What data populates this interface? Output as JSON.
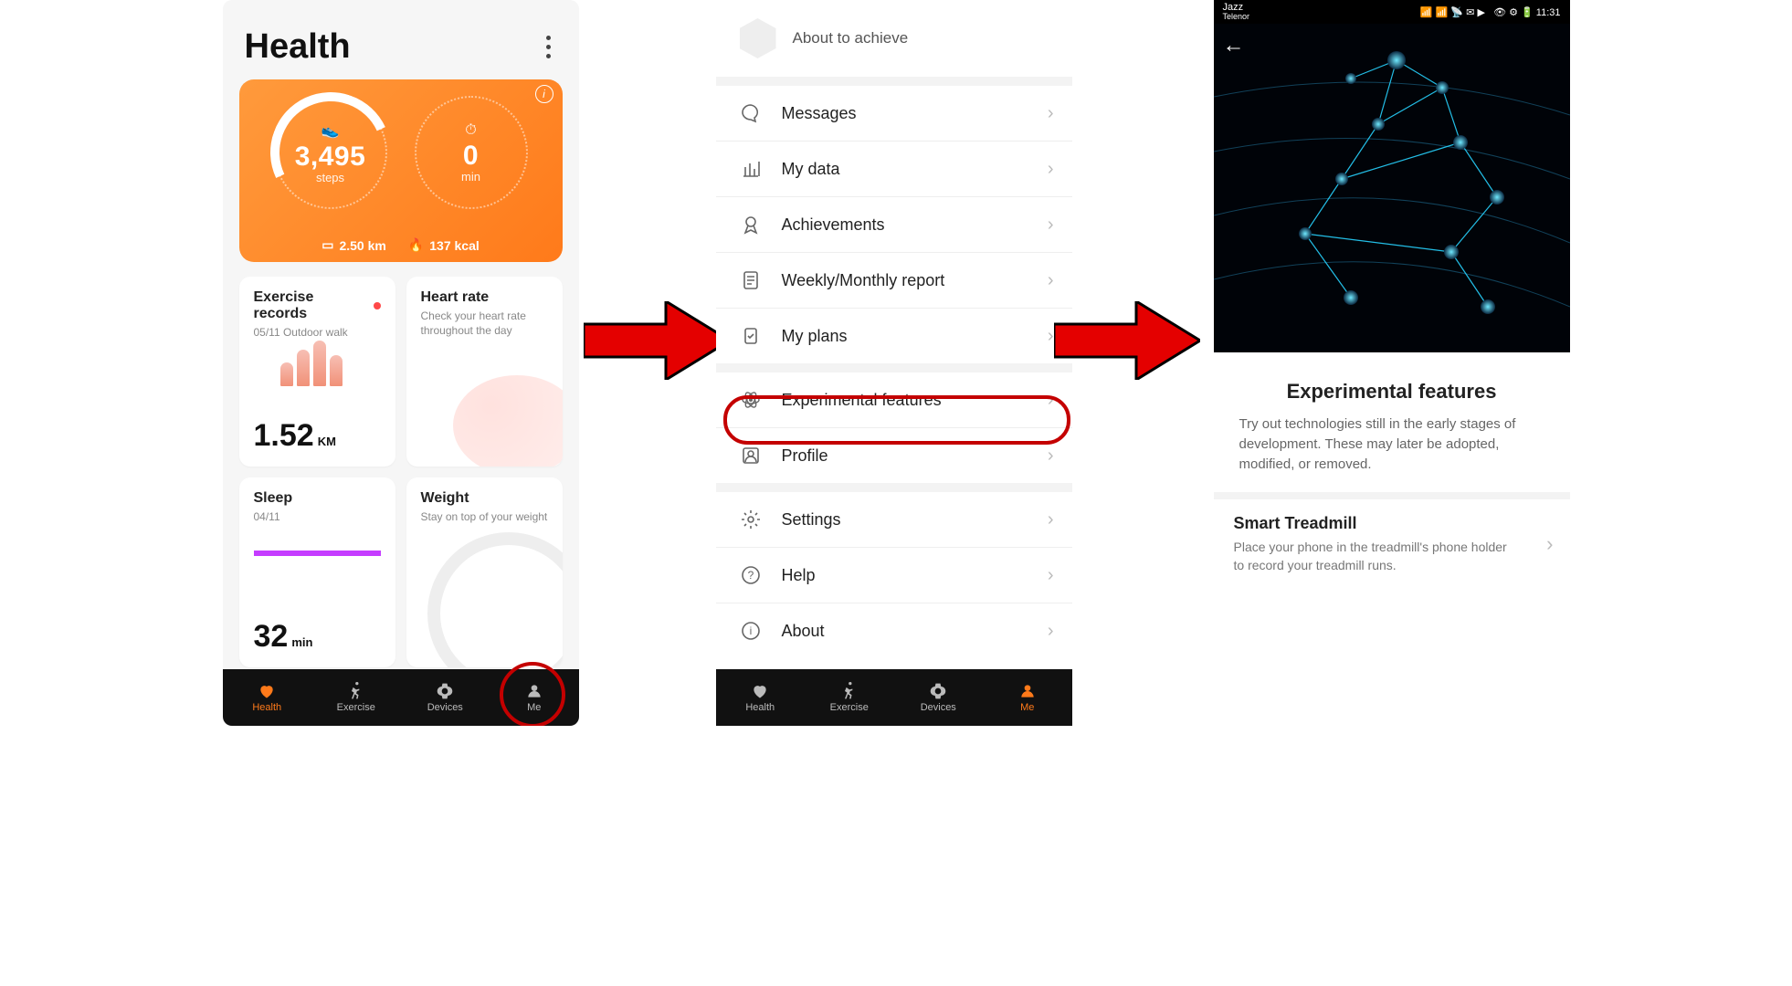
{
  "phone1": {
    "title": "Health",
    "steps_value": "3,495",
    "steps_label": "steps",
    "min_value": "0",
    "min_label": "min",
    "distance": "2.50 km",
    "calories": "137 kcal",
    "cards": {
      "exercise": {
        "title": "Exercise records",
        "subtitle": "05/11 Outdoor walk",
        "value": "1.52",
        "unit": "KM"
      },
      "heart": {
        "title": "Heart rate",
        "subtitle": "Check your heart rate throughout the day"
      },
      "sleep": {
        "title": "Sleep",
        "subtitle": "04/11",
        "value": "32",
        "unit": "min"
      },
      "weight": {
        "title": "Weight",
        "subtitle": "Stay on top of your weight"
      }
    },
    "nav": {
      "health": "Health",
      "exercise": "Exercise",
      "devices": "Devices",
      "me": "Me"
    }
  },
  "phone2": {
    "achieve": "About to achieve",
    "items": [
      "Messages",
      "My data",
      "Achievements",
      "Weekly/Monthly report",
      "My plans",
      "Experimental features",
      "Profile",
      "Settings",
      "Help",
      "About"
    ],
    "nav": {
      "health": "Health",
      "exercise": "Exercise",
      "devices": "Devices",
      "me": "Me"
    }
  },
  "phone3": {
    "carrier": "Jazz",
    "carrier2": "Telenor",
    "time": "11:31",
    "title": "Experimental features",
    "description": "Try out technologies still in the early stages of development. These may later be adopted, modified, or removed.",
    "item": {
      "title": "Smart Treadmill",
      "desc": "Place your phone in the treadmill's phone holder to record your treadmill runs."
    }
  }
}
